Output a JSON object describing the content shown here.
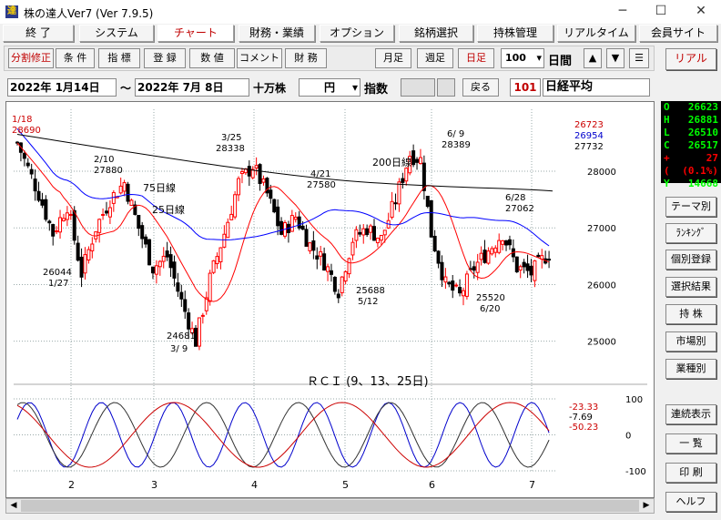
{
  "window": {
    "title": "株の達人Ver7 (Ver 7.9.5)",
    "icon": "達",
    "min": "─",
    "max": "☐",
    "close": "✕"
  },
  "menu": [
    {
      "label": "終 了"
    },
    {
      "label": "システム"
    },
    {
      "label": "チャート",
      "active": true
    },
    {
      "label": "財務・業績"
    },
    {
      "label": "オプション"
    },
    {
      "label": "銘柄選択"
    },
    {
      "label": "持株管理"
    },
    {
      "label": "リアルタイム"
    },
    {
      "label": "会員サイト"
    }
  ],
  "toolbar": {
    "buttons": [
      "分割修正",
      "条 件",
      "指 標",
      "登 録",
      "数 値",
      "コメント",
      "財 務"
    ],
    "periods": [
      "月足",
      "週足",
      "日足"
    ],
    "count": "100",
    "count_unit": "日間",
    "up": "▲",
    "down": "▼",
    "menu_icon": "☰"
  },
  "real_button": "リアル",
  "datebar": {
    "from": "2022年 1月14日",
    "tilde": "～",
    "to": "2022年 7月 8日",
    "unit": "十万株",
    "currency": "円",
    "kind": "指数",
    "back": "戻る",
    "code": "101",
    "name": "日経平均"
  },
  "ohlc": [
    {
      "k": "O",
      "v": "26623",
      "c": "#00ff00"
    },
    {
      "k": "H",
      "v": "26881",
      "c": "#00ff00"
    },
    {
      "k": "L",
      "v": "26510",
      "c": "#00ff00"
    },
    {
      "k": "C",
      "v": "26517",
      "c": "#00ff00"
    },
    {
      "k": "+",
      "v": "27",
      "c": "#ff0000"
    },
    {
      "k": "(",
      "v": "(0.1%)",
      "c": "#ff0000"
    },
    {
      "k": "Y",
      "v": "14668",
      "c": "#00ff00"
    }
  ],
  "right_buttons": [
    "テーマ別",
    "ﾗﾝｷﾝｸﾞ",
    "個別登録",
    "選択結果",
    "持 株",
    "市場別",
    "業種別",
    "連続表示",
    "一 覧",
    "印 刷",
    "ヘルフ"
  ],
  "chart_data": {
    "type": "candlestick",
    "y_ticks": [
      "28000",
      "27000",
      "26000",
      "25000"
    ],
    "x_labels": [
      "2",
      "3",
      "4",
      "5",
      "6",
      "7"
    ],
    "ma_values": [
      {
        "v": "26723",
        "c": "#cc0000"
      },
      {
        "v": "26954",
        "c": "#0000cc"
      },
      {
        "v": "27732",
        "c": "#000000"
      }
    ],
    "ma_labels": [
      "200日線",
      "75日線",
      "25日線"
    ],
    "annotations": [
      {
        "t": "1/18"
      },
      {
        "t": "28690"
      },
      {
        "t": "2/10"
      },
      {
        "t": "27880"
      },
      {
        "t": "26044"
      },
      {
        "t": "1/27"
      },
      {
        "t": "24681"
      },
      {
        "t": "3/ 9"
      },
      {
        "t": "3/25"
      },
      {
        "t": "28338"
      },
      {
        "t": "4/21"
      },
      {
        "t": "27580"
      },
      {
        "t": "25688"
      },
      {
        "t": "5/12"
      },
      {
        "t": "6/ 9"
      },
      {
        "t": "28389"
      },
      {
        "t": "6/28"
      },
      {
        "t": "27062"
      },
      {
        "t": "25520"
      },
      {
        "t": "6/20"
      }
    ],
    "rci_title": "ＲＣＩ (9、13、25日)",
    "rci_ticks": [
      "100",
      "0",
      "-100"
    ],
    "rci_values": [
      {
        "v": "-23.33",
        "c": "#cc0000"
      },
      {
        "v": "-7.69",
        "c": "#000000"
      },
      {
        "v": "-50.23",
        "c": "#cc0000"
      }
    ],
    "colors": {
      "up": "#ff0000",
      "down": "#000000",
      "ma25": "#ff0000",
      "ma75": "#0000ff",
      "ma200": "#000000"
    }
  }
}
